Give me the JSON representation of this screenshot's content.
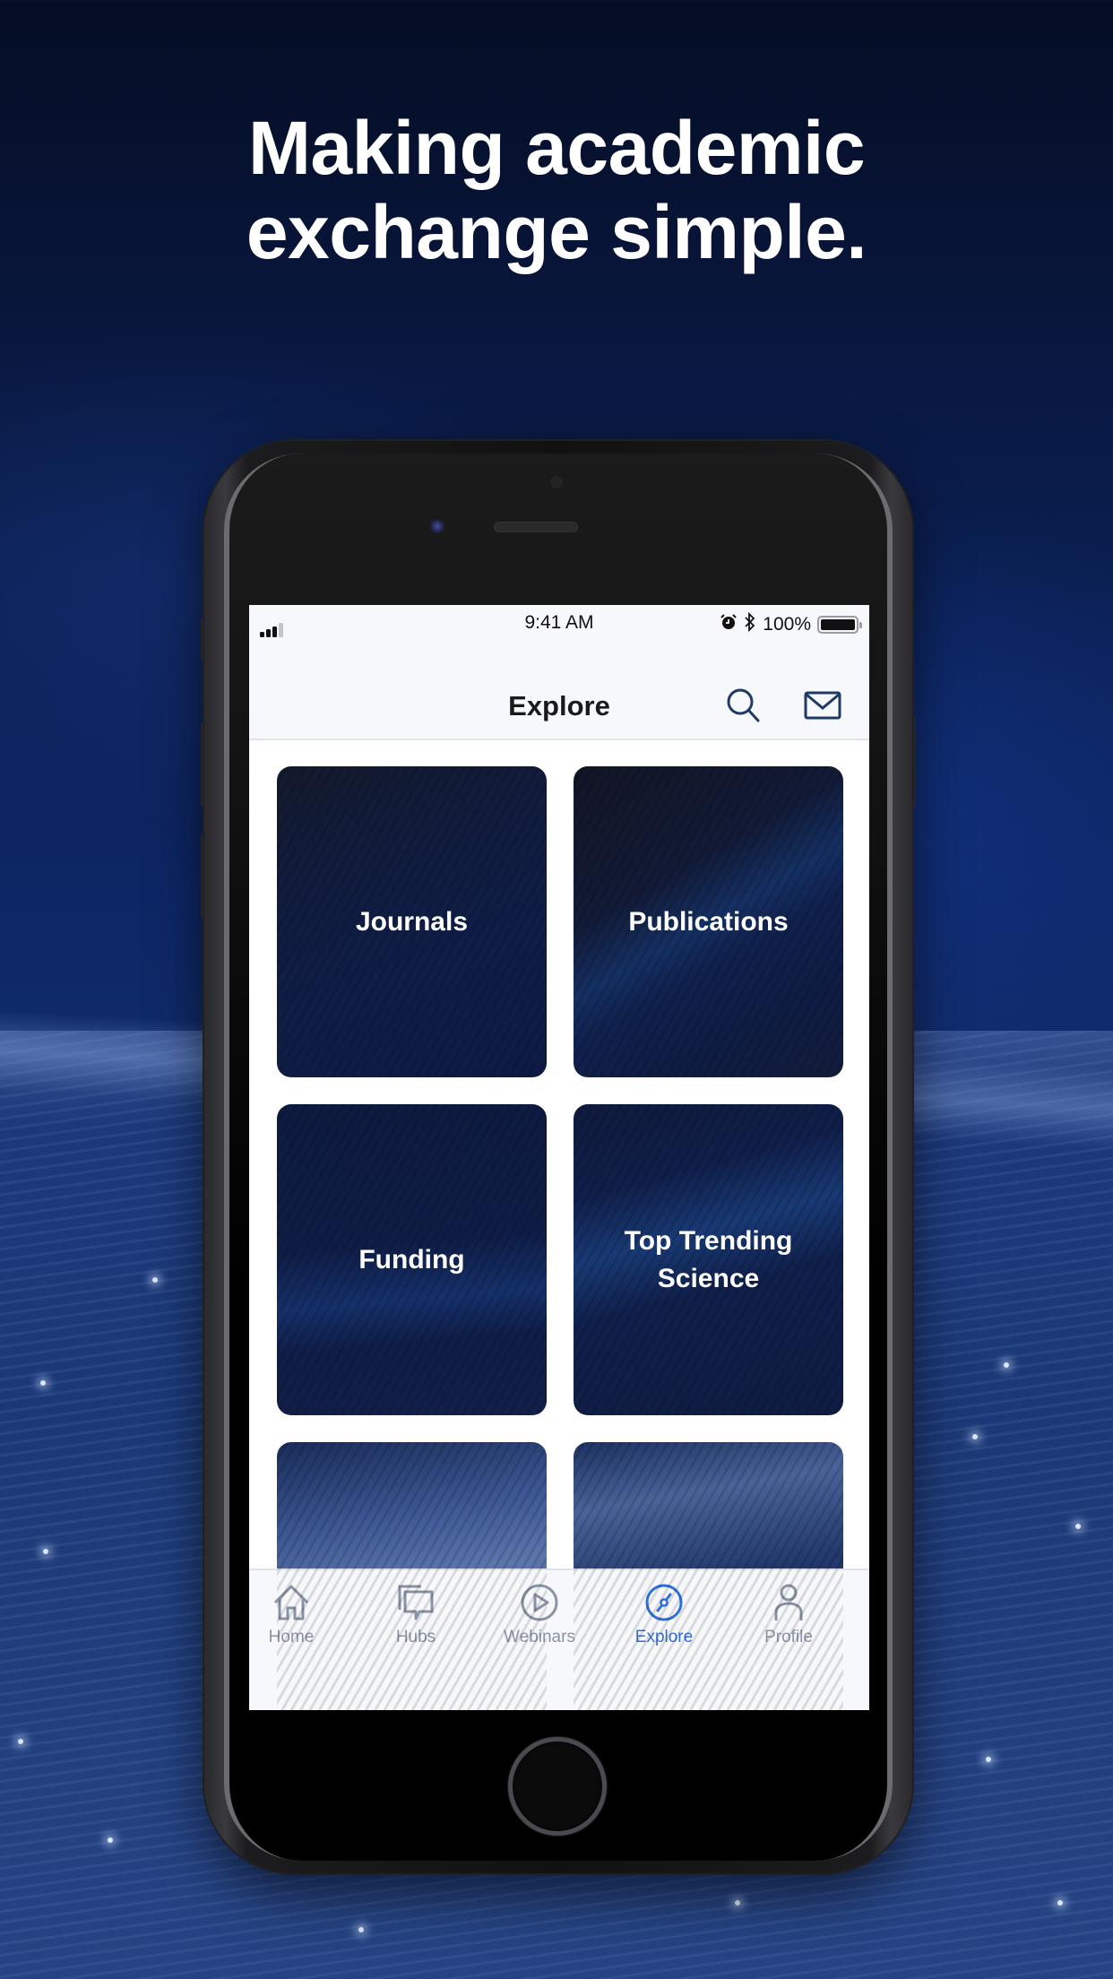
{
  "headline": {
    "line1": "Making academic",
    "line2": "exchange simple."
  },
  "status_bar": {
    "time": "9:41 AM",
    "battery_text": "100%",
    "battery_level": 1.0,
    "signal_bars_active": 3,
    "signal_bars_total": 4,
    "icons": [
      "signal-icon",
      "alarm-icon",
      "bluetooth-icon",
      "battery-icon"
    ]
  },
  "nav": {
    "title": "Explore",
    "actions": [
      {
        "name": "search",
        "icon": "search-icon"
      },
      {
        "name": "messages",
        "icon": "mail-icon"
      }
    ]
  },
  "cards": [
    {
      "label": "Journals"
    },
    {
      "label": "Publications"
    },
    {
      "label": "Funding"
    },
    {
      "label": "Top Trending Science"
    },
    {
      "label": ""
    },
    {
      "label": ""
    }
  ],
  "tabs": [
    {
      "label": "Home",
      "icon": "home-icon",
      "active": false
    },
    {
      "label": "Hubs",
      "icon": "chat-bubbles-icon",
      "active": false
    },
    {
      "label": "Webinars",
      "icon": "play-circle-icon",
      "active": false
    },
    {
      "label": "Explore",
      "icon": "compass-icon",
      "active": true
    },
    {
      "label": "Profile",
      "icon": "person-icon",
      "active": false
    }
  ],
  "colors": {
    "accent_active": "#2f6fdb",
    "tab_inactive": "#8a93a6",
    "card_navy": "#0f1d44",
    "nav_icon": "#1f3a66",
    "background_navy": "#0a1c4a"
  }
}
